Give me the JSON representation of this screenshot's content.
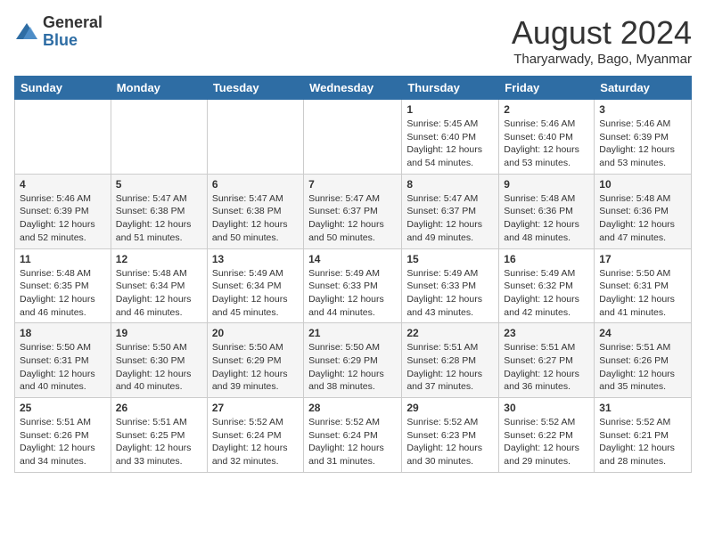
{
  "header": {
    "logo_general": "General",
    "logo_blue": "Blue",
    "month_year": "August 2024",
    "location": "Tharyarwady, Bago, Myanmar"
  },
  "days_of_week": [
    "Sunday",
    "Monday",
    "Tuesday",
    "Wednesday",
    "Thursday",
    "Friday",
    "Saturday"
  ],
  "weeks": [
    [
      {
        "day": "",
        "info": ""
      },
      {
        "day": "",
        "info": ""
      },
      {
        "day": "",
        "info": ""
      },
      {
        "day": "",
        "info": ""
      },
      {
        "day": "1",
        "info": "Sunrise: 5:45 AM\nSunset: 6:40 PM\nDaylight: 12 hours\nand 54 minutes."
      },
      {
        "day": "2",
        "info": "Sunrise: 5:46 AM\nSunset: 6:40 PM\nDaylight: 12 hours\nand 53 minutes."
      },
      {
        "day": "3",
        "info": "Sunrise: 5:46 AM\nSunset: 6:39 PM\nDaylight: 12 hours\nand 53 minutes."
      }
    ],
    [
      {
        "day": "4",
        "info": "Sunrise: 5:46 AM\nSunset: 6:39 PM\nDaylight: 12 hours\nand 52 minutes."
      },
      {
        "day": "5",
        "info": "Sunrise: 5:47 AM\nSunset: 6:38 PM\nDaylight: 12 hours\nand 51 minutes."
      },
      {
        "day": "6",
        "info": "Sunrise: 5:47 AM\nSunset: 6:38 PM\nDaylight: 12 hours\nand 50 minutes."
      },
      {
        "day": "7",
        "info": "Sunrise: 5:47 AM\nSunset: 6:37 PM\nDaylight: 12 hours\nand 50 minutes."
      },
      {
        "day": "8",
        "info": "Sunrise: 5:47 AM\nSunset: 6:37 PM\nDaylight: 12 hours\nand 49 minutes."
      },
      {
        "day": "9",
        "info": "Sunrise: 5:48 AM\nSunset: 6:36 PM\nDaylight: 12 hours\nand 48 minutes."
      },
      {
        "day": "10",
        "info": "Sunrise: 5:48 AM\nSunset: 6:36 PM\nDaylight: 12 hours\nand 47 minutes."
      }
    ],
    [
      {
        "day": "11",
        "info": "Sunrise: 5:48 AM\nSunset: 6:35 PM\nDaylight: 12 hours\nand 46 minutes."
      },
      {
        "day": "12",
        "info": "Sunrise: 5:48 AM\nSunset: 6:34 PM\nDaylight: 12 hours\nand 46 minutes."
      },
      {
        "day": "13",
        "info": "Sunrise: 5:49 AM\nSunset: 6:34 PM\nDaylight: 12 hours\nand 45 minutes."
      },
      {
        "day": "14",
        "info": "Sunrise: 5:49 AM\nSunset: 6:33 PM\nDaylight: 12 hours\nand 44 minutes."
      },
      {
        "day": "15",
        "info": "Sunrise: 5:49 AM\nSunset: 6:33 PM\nDaylight: 12 hours\nand 43 minutes."
      },
      {
        "day": "16",
        "info": "Sunrise: 5:49 AM\nSunset: 6:32 PM\nDaylight: 12 hours\nand 42 minutes."
      },
      {
        "day": "17",
        "info": "Sunrise: 5:50 AM\nSunset: 6:31 PM\nDaylight: 12 hours\nand 41 minutes."
      }
    ],
    [
      {
        "day": "18",
        "info": "Sunrise: 5:50 AM\nSunset: 6:31 PM\nDaylight: 12 hours\nand 40 minutes."
      },
      {
        "day": "19",
        "info": "Sunrise: 5:50 AM\nSunset: 6:30 PM\nDaylight: 12 hours\nand 40 minutes."
      },
      {
        "day": "20",
        "info": "Sunrise: 5:50 AM\nSunset: 6:29 PM\nDaylight: 12 hours\nand 39 minutes."
      },
      {
        "day": "21",
        "info": "Sunrise: 5:50 AM\nSunset: 6:29 PM\nDaylight: 12 hours\nand 38 minutes."
      },
      {
        "day": "22",
        "info": "Sunrise: 5:51 AM\nSunset: 6:28 PM\nDaylight: 12 hours\nand 37 minutes."
      },
      {
        "day": "23",
        "info": "Sunrise: 5:51 AM\nSunset: 6:27 PM\nDaylight: 12 hours\nand 36 minutes."
      },
      {
        "day": "24",
        "info": "Sunrise: 5:51 AM\nSunset: 6:26 PM\nDaylight: 12 hours\nand 35 minutes."
      }
    ],
    [
      {
        "day": "25",
        "info": "Sunrise: 5:51 AM\nSunset: 6:26 PM\nDaylight: 12 hours\nand 34 minutes."
      },
      {
        "day": "26",
        "info": "Sunrise: 5:51 AM\nSunset: 6:25 PM\nDaylight: 12 hours\nand 33 minutes."
      },
      {
        "day": "27",
        "info": "Sunrise: 5:52 AM\nSunset: 6:24 PM\nDaylight: 12 hours\nand 32 minutes."
      },
      {
        "day": "28",
        "info": "Sunrise: 5:52 AM\nSunset: 6:24 PM\nDaylight: 12 hours\nand 31 minutes."
      },
      {
        "day": "29",
        "info": "Sunrise: 5:52 AM\nSunset: 6:23 PM\nDaylight: 12 hours\nand 30 minutes."
      },
      {
        "day": "30",
        "info": "Sunrise: 5:52 AM\nSunset: 6:22 PM\nDaylight: 12 hours\nand 29 minutes."
      },
      {
        "day": "31",
        "info": "Sunrise: 5:52 AM\nSunset: 6:21 PM\nDaylight: 12 hours\nand 28 minutes."
      }
    ]
  ]
}
